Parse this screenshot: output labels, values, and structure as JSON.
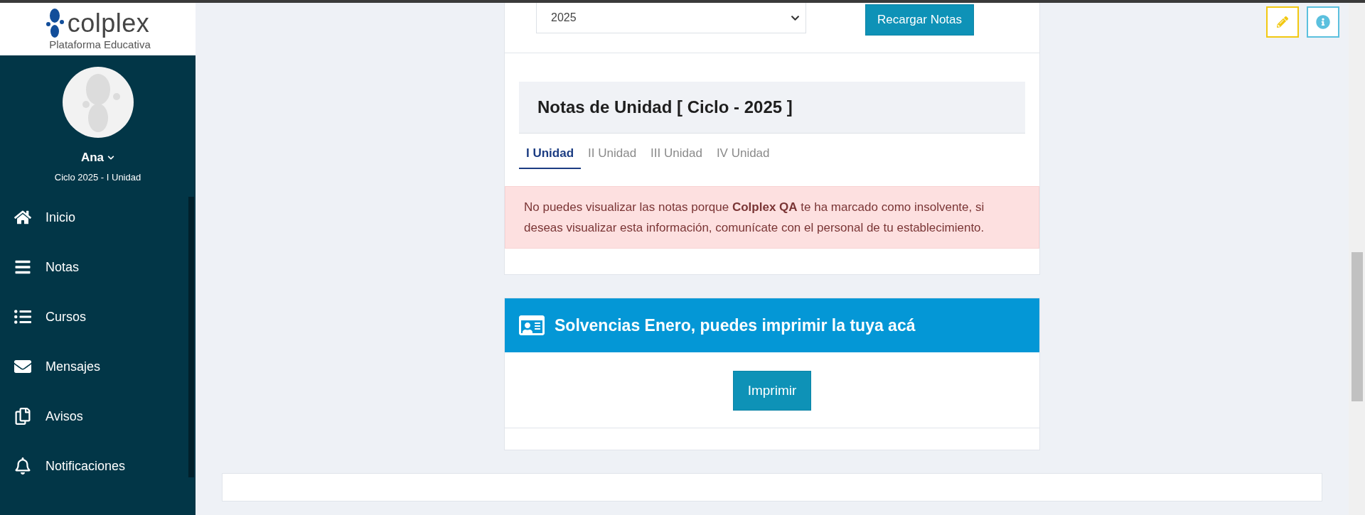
{
  "logo": {
    "name": "colplex",
    "tagline": "Plataforma Educativa"
  },
  "user": {
    "name": "Ana",
    "cycle": "Ciclo 2025 - I Unidad"
  },
  "nav": [
    {
      "label": "Inicio",
      "kind": "home"
    },
    {
      "label": "Notas",
      "kind": "bars"
    },
    {
      "label": "Cursos",
      "kind": "list"
    },
    {
      "label": "Mensajes",
      "kind": "mail"
    },
    {
      "label": "Avisos",
      "kind": "copy"
    },
    {
      "label": "Notificaciones",
      "kind": "bell"
    }
  ],
  "filter": {
    "year": "2025",
    "reload_button": "Recargar Notas"
  },
  "grades": {
    "title": "Notas de Unidad [ Ciclo - 2025 ]",
    "tabs": [
      {
        "label": "I Unidad",
        "selected": true
      },
      {
        "label": "II Unidad",
        "selected": false
      },
      {
        "label": "III Unidad",
        "selected": false
      },
      {
        "label": "IV Unidad",
        "selected": false
      }
    ],
    "alert": "No puedes visualizar las notas porque **Colplex QA** te ha marcado como insolvente, si deseas visualizar esta información, comunícate con el personal de tu establecimiento."
  },
  "solvency": {
    "title": "Solvencias Enero, puedes imprimir la tuya acá",
    "button": "Imprimir"
  },
  "toolbar": [
    {
      "kind": "edit"
    },
    {
      "kind": "info"
    }
  ]
}
